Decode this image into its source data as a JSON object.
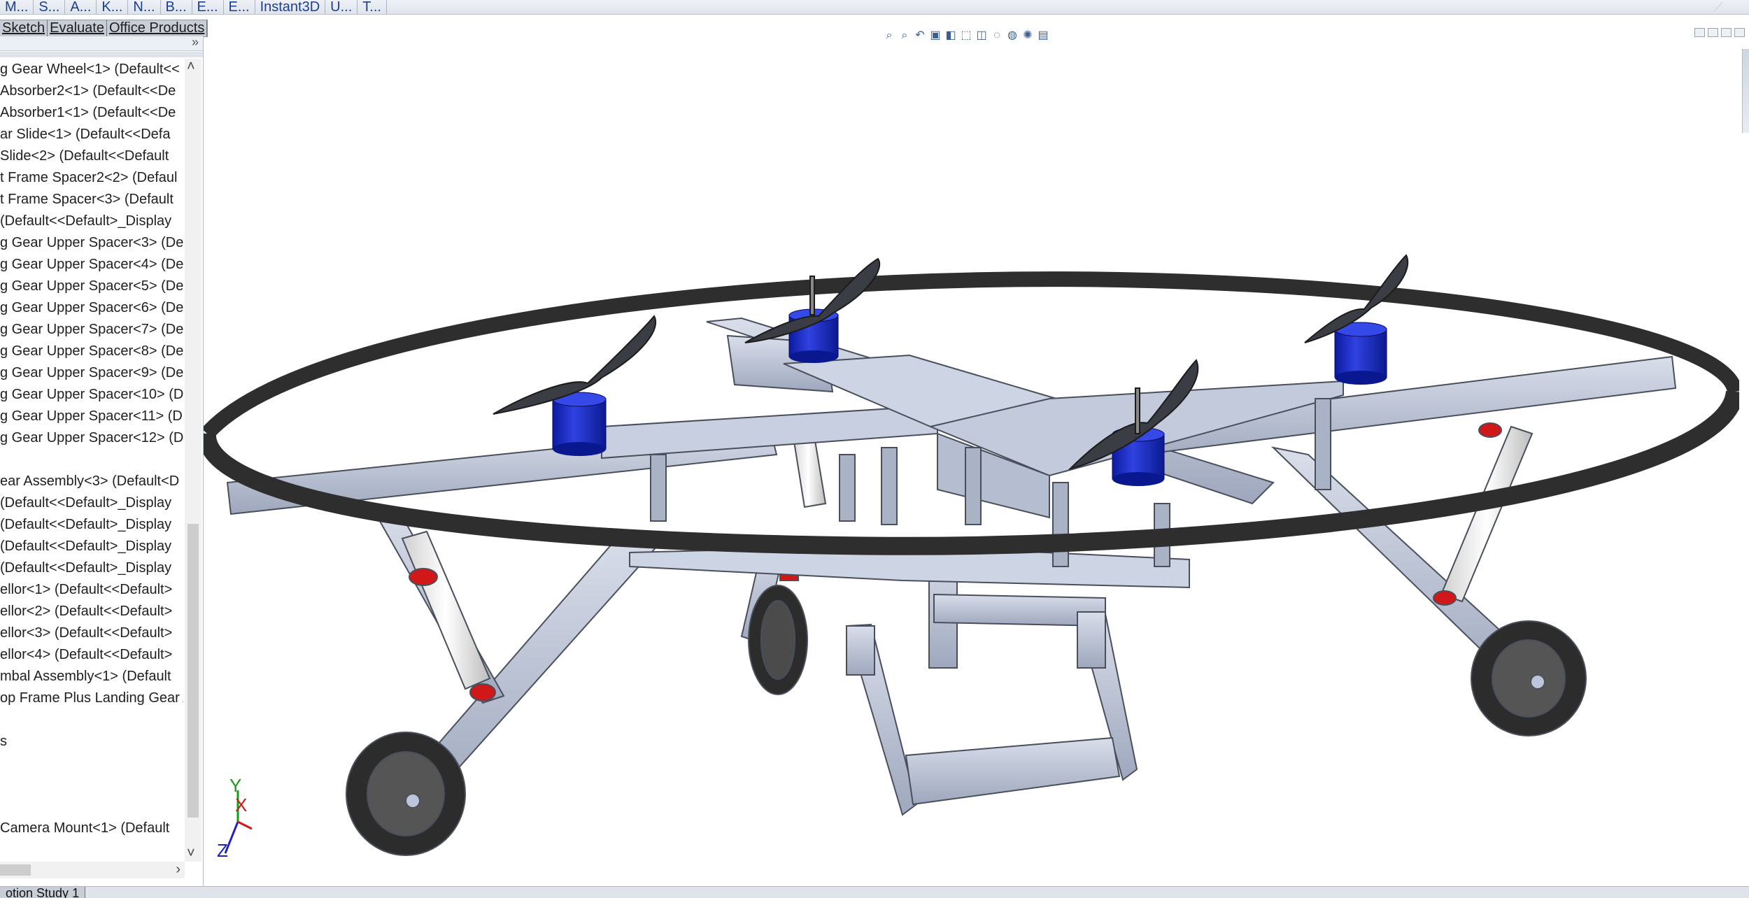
{
  "ribbon": {
    "tabs": [
      "M...",
      "S...",
      "A...",
      "K...",
      "N...",
      "B...",
      "E...",
      "E...",
      "Instant3D",
      "U...",
      "T..."
    ]
  },
  "command_tabs": [
    "Sketch",
    "Evaluate",
    "Office Products"
  ],
  "tree": {
    "items": [
      "g Gear Wheel<1> (Default<<",
      "Absorber2<1> (Default<<De",
      "Absorber1<1> (Default<<De",
      "ar Slide<1> (Default<<Defa",
      "Slide<2> (Default<<Default",
      "t Frame Spacer2<2> (Defaul",
      "t Frame Spacer<3> (Default",
      "(Default<<Default>_Display",
      "g Gear Upper Spacer<3> (De",
      "g Gear Upper Spacer<4> (De",
      "g Gear Upper Spacer<5> (De",
      "g Gear Upper Spacer<6> (De",
      "g Gear Upper Spacer<7> (De",
      "g Gear Upper Spacer<8> (De",
      "g Gear Upper Spacer<9> (De",
      "g Gear Upper Spacer<10> (D",
      "g Gear Upper Spacer<11> (D",
      "g Gear Upper Spacer<12> (D",
      "",
      "ear Assembly<3> (Default<D",
      "(Default<<Default>_Display",
      "(Default<<Default>_Display",
      "(Default<<Default>_Display",
      "(Default<<Default>_Display",
      "ellor<1> (Default<<Default>",
      "ellor<2> (Default<<Default>",
      "ellor<3> (Default<<Default>",
      "ellor<4> (Default<<Default>",
      "mbal Assembly<1> (Default",
      "op Frame Plus Landing Gear A",
      "",
      "s",
      "",
      "",
      "",
      "Camera Mount<1> (Default"
    ]
  },
  "bottom_tab": "otion Study 1",
  "colors": {
    "part": "#bcc5da",
    "edge": "#4a4f5c",
    "motor": "#1f2fbf",
    "ring": "#2e2e2e",
    "accent_red": "#d01818"
  },
  "triad": {
    "x_label": "X",
    "y_label": "Y",
    "z_label": "Z"
  }
}
